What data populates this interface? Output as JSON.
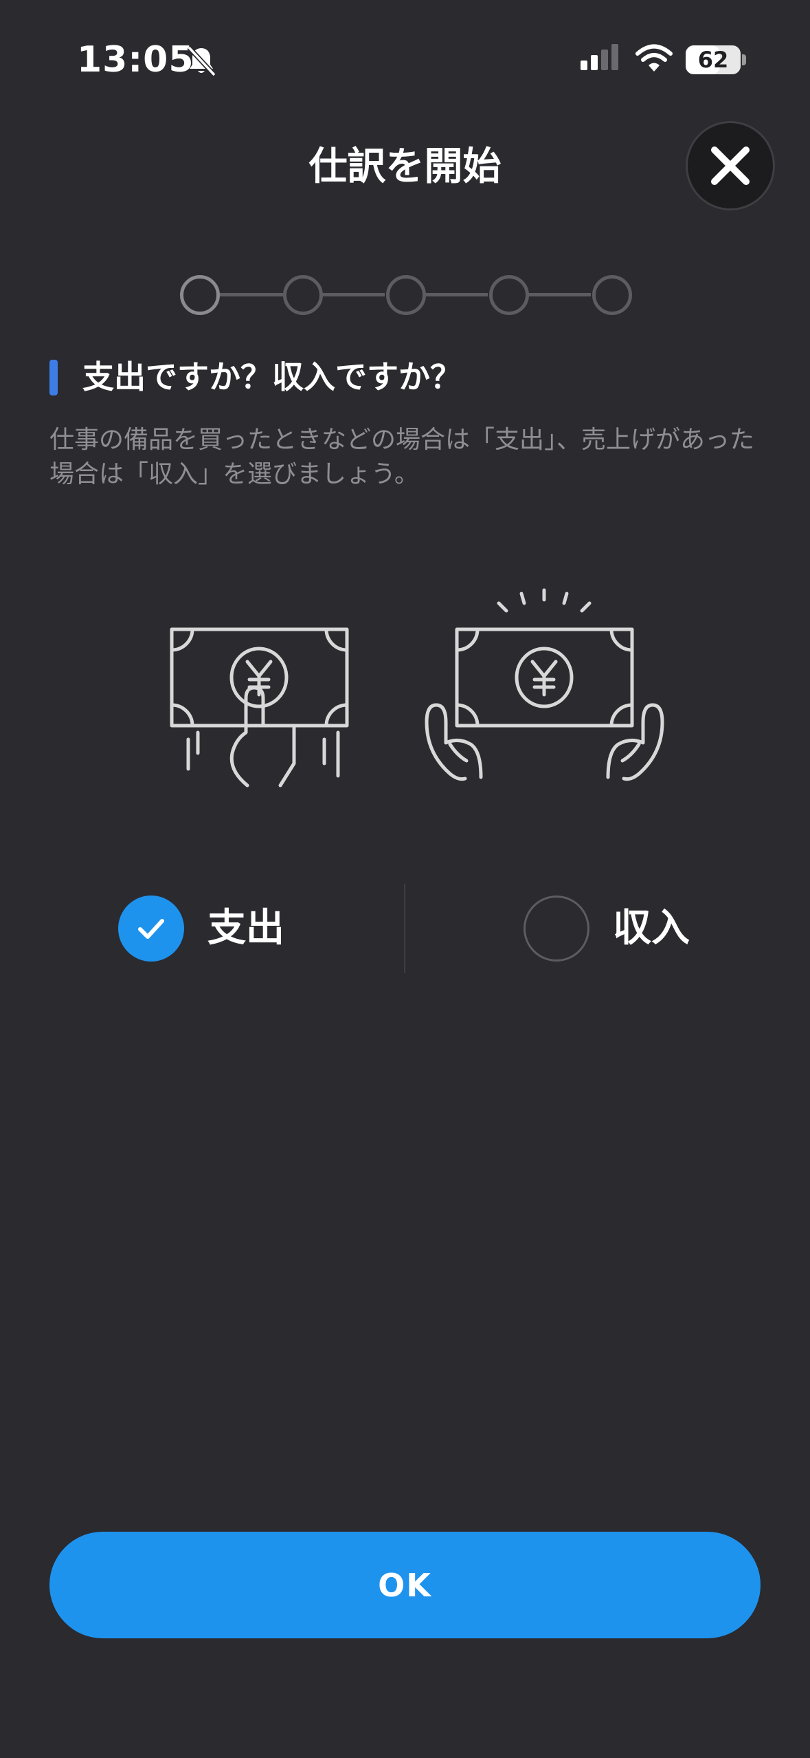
{
  "status_bar": {
    "time": "13:05",
    "battery": "62",
    "battery_level": 0.62,
    "icons": [
      "bell-slash-icon",
      "cellular-signal-icon",
      "wifi-icon",
      "battery-icon"
    ]
  },
  "header": {
    "title": "仕訳を開始",
    "close_icon": "close-icon"
  },
  "stepper": {
    "total_steps": 5,
    "current_step": 1
  },
  "question": {
    "title": "支出ですか？収入ですか？",
    "description": "仕事の備品を買ったときなどの場合は「支出」、売上げがあった場合は「収入」を選びましょう。"
  },
  "options": {
    "expense": {
      "label": "支出",
      "selected": true,
      "icon": "paying-money-yen-icon"
    },
    "income": {
      "label": "収入",
      "selected": false,
      "icon": "receiving-money-yen-icon"
    }
  },
  "footer": {
    "ok_label": "OK"
  },
  "colors": {
    "background": "#2a2a2f",
    "accent": "#1e93ee",
    "heading_bar": "#3d7ee6",
    "muted_text": "#8e8e93"
  }
}
